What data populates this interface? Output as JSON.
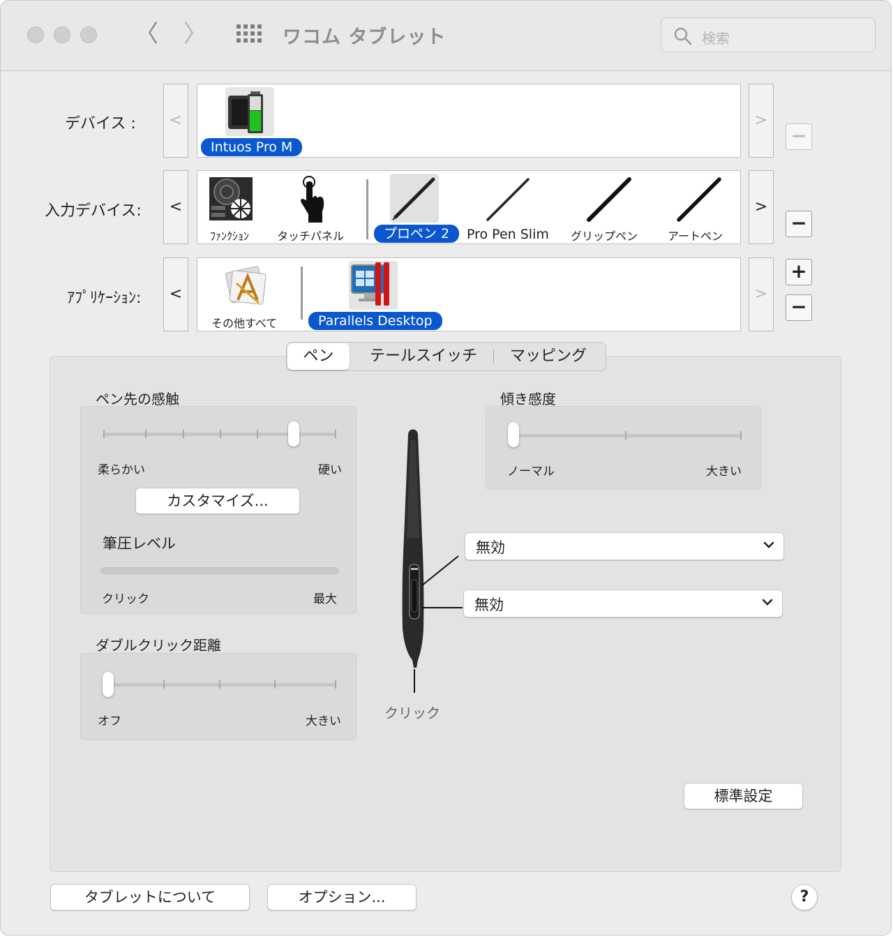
{
  "window": {
    "title": "ワコム タブレット"
  },
  "toolbar": {
    "back_label": "〈",
    "forward_label": "〉",
    "search_placeholder": "検索"
  },
  "rows": {
    "device": {
      "label": "デバイス :",
      "items": [
        {
          "label": "Intuos Pro M",
          "selected": true
        }
      ]
    },
    "input": {
      "label": "入力デバイス:",
      "items": [
        {
          "label": "ﾌｧﾝｸｼｮﾝ"
        },
        {
          "label": "タッチパネル"
        },
        {
          "label": "プロペン 2",
          "selected": true
        },
        {
          "label": "Pro Pen Slim"
        },
        {
          "label": "グリップペン"
        },
        {
          "label": "アートペン"
        }
      ]
    },
    "app": {
      "label": "ｱﾌﾟﾘｹｰｼｮﾝ:",
      "items": [
        {
          "label": "その他すべて"
        },
        {
          "label": "Parallels Desktop",
          "selected": true
        }
      ]
    },
    "arrow_left": "<",
    "arrow_right": ">"
  },
  "side_buttons": {
    "minus": "−",
    "plus": "+"
  },
  "tabs": [
    {
      "label": "ペン",
      "selected": true
    },
    {
      "label": "テールスイッチ"
    },
    {
      "label": "マッピング"
    }
  ],
  "tip_feel": {
    "title": "ペン先の感触",
    "min": "柔らかい",
    "max": "硬い",
    "level": 0.82,
    "customize": "カスタマイズ..."
  },
  "pressure": {
    "title": "筆圧レベル",
    "min": "クリック",
    "max": "最大",
    "level": 0
  },
  "double_click": {
    "title": "ダブルクリック距離",
    "min": "オフ",
    "max": "大きい",
    "level": 0
  },
  "tilt": {
    "title": "傾き感度",
    "min": "ノーマル",
    "max": "大きい",
    "level": 0
  },
  "pen_buttons": {
    "upper": "無効",
    "lower": "無効",
    "tip": "クリック"
  },
  "default_button": "標準設定",
  "footer": {
    "about": "タブレットについて",
    "options": "オプション...",
    "help": "?"
  },
  "colors": {
    "selection": "#0b57d0",
    "battery": "#22c122"
  }
}
